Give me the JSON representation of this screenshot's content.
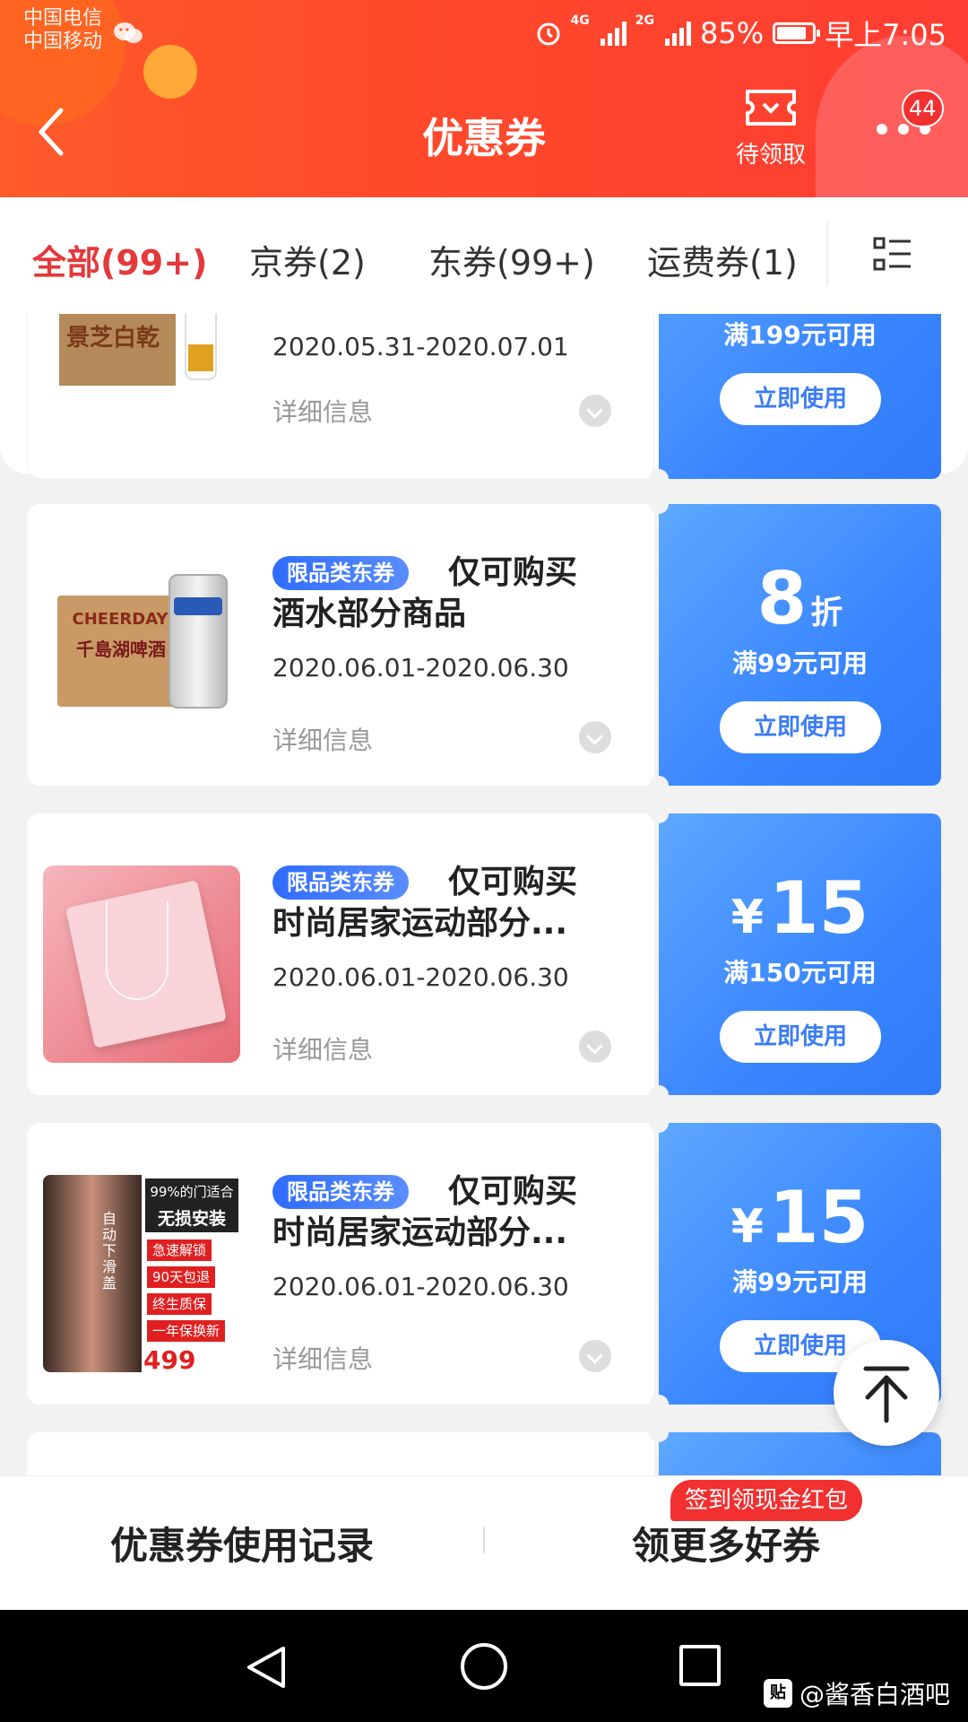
{
  "status_bar": {
    "carrier1": "中国电信",
    "carrier2": "中国移动",
    "net1": "4G",
    "net2": "2G",
    "battery_percent": "85%",
    "battery_level": 0.85,
    "time": "早上7:05"
  },
  "header": {
    "title": "优惠券",
    "pending_label": "待领取",
    "more_badge": "44"
  },
  "tabs": [
    {
      "label": "全部(99+)",
      "active": true
    },
    {
      "label": "京券(2)",
      "active": false
    },
    {
      "label": "东券(99+)",
      "active": false
    },
    {
      "label": "运费券(1)",
      "active": false
    }
  ],
  "partial_card": {
    "product_text": "景芝白乾",
    "date": "2020.05.31-2020.07.01",
    "detail_label": "详细信息",
    "condition": "满199元可用",
    "use_label": "立即使用"
  },
  "coupons": [
    {
      "tag": "限品类东券",
      "title_line1": "仅可购买",
      "title_line2": "酒水部分商品",
      "date": "2020.06.01-2020.06.30",
      "detail_label": "详细信息",
      "amount": "8",
      "amount_unit": "折",
      "condition": "满99元可用",
      "use_label": "立即使用",
      "thumb_text": "千島湖啤酒",
      "thumb_brand": "CHEERDAY"
    },
    {
      "tag": "限品类东券",
      "title_line1": "仅可购买",
      "title_line2": "时尚居家运动部分...",
      "date": "2020.06.01-2020.06.30",
      "detail_label": "详细信息",
      "currency": "¥",
      "amount": "15",
      "condition": "满150元可用",
      "use_label": "立即使用"
    },
    {
      "tag": "限品类东券",
      "title_line1": "仅可购买",
      "title_line2": "时尚居家运动部分...",
      "date": "2020.06.01-2020.06.30",
      "detail_label": "详细信息",
      "currency": "¥",
      "amount": "15",
      "condition": "满99元可用",
      "use_label": "立即使用",
      "thumb_lines": [
        "99%的门适合",
        "无损安装",
        "急速解锁",
        "90天包退",
        "终生质保",
        "一年保换新"
      ],
      "thumb_side": "自动下滑盖",
      "thumb_price": "499"
    }
  ],
  "bottom_bar": {
    "history_label": "优惠券使用记录",
    "more_label": "领更多好券",
    "promo_badge": "签到领现金红包"
  },
  "watermark": {
    "logo": "贴",
    "text": "@酱香白酒吧"
  },
  "colors": {
    "header_red": "#ff4a2a",
    "active_tab": "#e4393c",
    "coupon_blue": "#3a86ff",
    "badge_red": "#f23030"
  }
}
